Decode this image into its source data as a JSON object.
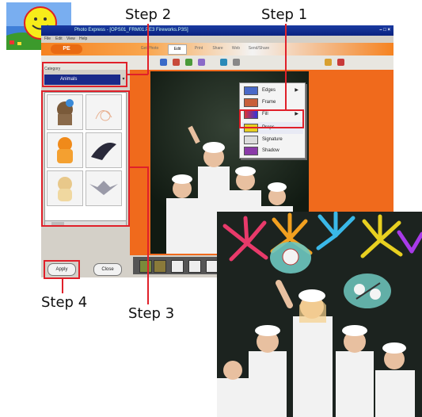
{
  "steps": {
    "step1": "Step 1",
    "step2": "Step 2",
    "step3": "Step 3",
    "step4": "Step 4"
  },
  "window": {
    "title": "Photo Express - [OPS01_FRM01.PE3 Fireworks.P3S]",
    "controls": "– □ ×"
  },
  "menubar": {
    "items": [
      "File",
      "Edit",
      "View",
      "Help"
    ]
  },
  "brand": {
    "label": "PE"
  },
  "nav": {
    "tabs": [
      "Get Photo",
      "Edit",
      "Print",
      "Share",
      "Web",
      "Send/Share"
    ],
    "selected": "Edit"
  },
  "left_panel": {
    "category_label": "Category",
    "category_value": "Animals",
    "thumbnails": [
      "cat-sticker",
      "bunny-sketch-sticker",
      "orange-cat-sticker",
      "dolphin-sticker",
      "puppy-sticker",
      "bat-sticker"
    ]
  },
  "buttons": {
    "apply": "Apply",
    "close": "Close"
  },
  "menu": {
    "items": [
      {
        "label": "Edges",
        "arrow": "▶"
      },
      {
        "label": "Frame",
        "arrow": ""
      },
      {
        "label": "Fill",
        "arrow": "▶"
      },
      {
        "label": "Props",
        "arrow": ""
      },
      {
        "label": "Signature",
        "arrow": ""
      },
      {
        "label": "Shadow",
        "arrow": ""
      }
    ]
  },
  "colors": {
    "accent": "#f58220",
    "highlight": "#e0202a",
    "title_bar": "#0a2280"
  }
}
